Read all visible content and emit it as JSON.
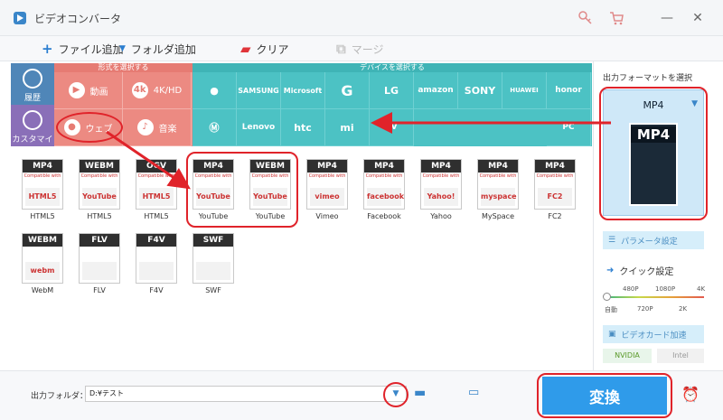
{
  "window": {
    "title": "ビデオコンバータ",
    "controls": {
      "minimize": "—",
      "close": "✕"
    }
  },
  "toolbar": {
    "add_file": "ファイル追加",
    "add_folder": "フォルダ追加",
    "clear": "クリア",
    "merge": "マージ"
  },
  "nav": {
    "format": "履歴",
    "custom": "カスタマイズ"
  },
  "panels": {
    "format_header": "形式を選択する",
    "device_header": "デバイスを選択する"
  },
  "format_tiles": [
    {
      "label": "動画",
      "icon": "play-icon"
    },
    {
      "label": "4K/HD",
      "icon": "4k-icon"
    },
    {
      "label": "ウェブ",
      "icon": "chrome-icon"
    },
    {
      "label": "音楽",
      "icon": "speaker-icon"
    }
  ],
  "device_tiles_row1": [
    "",
    "SAMSUNG",
    "Microsoft",
    "G",
    "LG",
    "amazon",
    "SONY",
    "HUAWEI",
    "honor"
  ],
  "device_tiles_row2": [
    "",
    "Lenovo",
    "htc",
    "mi",
    "TV",
    "",
    "",
    "",
    "PC"
  ],
  "grid": [
    {
      "top": "MP4",
      "mid": "Compatible with",
      "bot": "HTML5",
      "label": "HTML5"
    },
    {
      "top": "WEBM",
      "mid": "Compatible with",
      "bot": "YouTube",
      "label": "HTML5"
    },
    {
      "top": "OGV",
      "mid": "Compatible with",
      "bot": "HTML5",
      "label": "HTML5"
    },
    {
      "top": "MP4",
      "mid": "Compatible with",
      "bot": "YouTube",
      "label": "YouTube"
    },
    {
      "top": "WEBM",
      "mid": "Compatible with",
      "bot": "YouTube",
      "label": "YouTube"
    },
    {
      "top": "MP4",
      "mid": "Compatible with",
      "bot": "vimeo",
      "label": "Vimeo"
    },
    {
      "top": "MP4",
      "mid": "Compatible with",
      "bot": "facebook",
      "label": "Facebook"
    },
    {
      "top": "MP4",
      "mid": "Compatible with",
      "bot": "Yahoo!",
      "label": "Yahoo"
    },
    {
      "top": "MP4",
      "mid": "Compatible with",
      "bot": "myspace",
      "label": "MySpace"
    },
    {
      "top": "MP4",
      "mid": "Compatible with",
      "bot": "FC2",
      "label": "FC2"
    },
    {
      "top": "WEBM",
      "mid": "",
      "bot": "webm",
      "label": "WebM"
    },
    {
      "top": "FLV",
      "mid": "",
      "bot": "",
      "label": "FLV"
    },
    {
      "top": "F4V",
      "mid": "",
      "bot": "",
      "label": "F4V"
    },
    {
      "top": "SWF",
      "mid": "",
      "bot": "",
      "label": "SWF"
    }
  ],
  "sidebar": {
    "output_label": "出力フォーマットを選択",
    "format_name": "MP4",
    "param_settings": "パラメータ設定",
    "quick_settings": "クイック設定",
    "res_top": [
      "480P",
      "1080P",
      "4K"
    ],
    "res_bottom": [
      "自動",
      "720P",
      "2K"
    ],
    "gpu_accel": "ビデオカード加速",
    "gpu_nvidia": "NVIDIA",
    "gpu_intel": "Intel"
  },
  "bottom": {
    "output_folder_label": "出力フォルダ：",
    "output_folder_value": "D:¥テスト",
    "convert": "変換"
  }
}
